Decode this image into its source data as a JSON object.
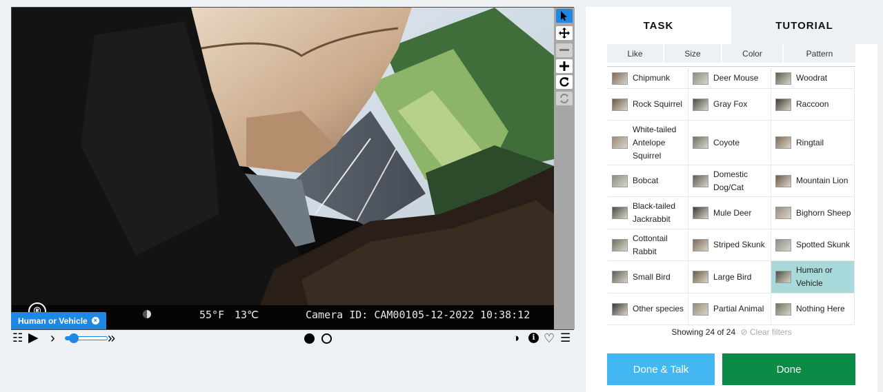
{
  "viewer": {
    "info_bar": {
      "logo": "®",
      "temp_f": "55°F",
      "temp_c": "13℃",
      "camera_id": "Camera ID: CAM001",
      "date": "05-12-2022",
      "time": "10:38:12"
    },
    "tools": [
      "pointer-icon",
      "move-icon",
      "zoom-out-icon",
      "zoom-in-icon",
      "rotate-icon",
      "reset-icon"
    ],
    "selected_tag": "Human or Vehicle",
    "tag_remove": "×"
  },
  "controls": {
    "grid_icon": "☷",
    "play_icon": "▶",
    "slow_icon": "›",
    "fast_icon": "»",
    "speed_level": 0.2,
    "frames": [
      {
        "selected": true
      },
      {
        "selected": false
      }
    ],
    "contrast_icon": "◑",
    "info_icon": "ℹ",
    "favorite_icon": "♡",
    "menu_icon": "☰"
  },
  "panel": {
    "tabs": [
      "TASK",
      "TUTORIAL"
    ],
    "filters": [
      "Like",
      "Size",
      "Color",
      "Pattern"
    ],
    "choices": [
      [
        "Chipmunk",
        "Deer Mouse",
        "Woodrat"
      ],
      [
        "Rock Squirrel",
        "Gray Fox",
        "Raccoon"
      ],
      [
        "White-tailed Antelope Squirrel",
        "Coyote",
        "Ringtail"
      ],
      [
        "Bobcat",
        "Domestic Dog/Cat",
        "Mountain Lion"
      ],
      [
        "Black-tailed Jackrabbit",
        "Mule Deer",
        "Bighorn Sheep"
      ],
      [
        "Cottontail Rabbit",
        "Striped Skunk",
        "Spotted Skunk"
      ],
      [
        "Small Bird",
        "Large Bird",
        "Human or Vehicle"
      ],
      [
        "Other species",
        "Partial Animal",
        "Nothing Here"
      ]
    ],
    "selected_choice": "Human or Vehicle",
    "showing_text": "Showing 24 of 24",
    "clear_filters": "⊘ Clear filters",
    "done_talk_label": "Done & Talk",
    "done_label": "Done"
  },
  "colors": {
    "accent": "#1e88e5",
    "selected_choice": "#a9dadb",
    "done_talk": "#43b7f2",
    "done": "#0a8c46"
  }
}
